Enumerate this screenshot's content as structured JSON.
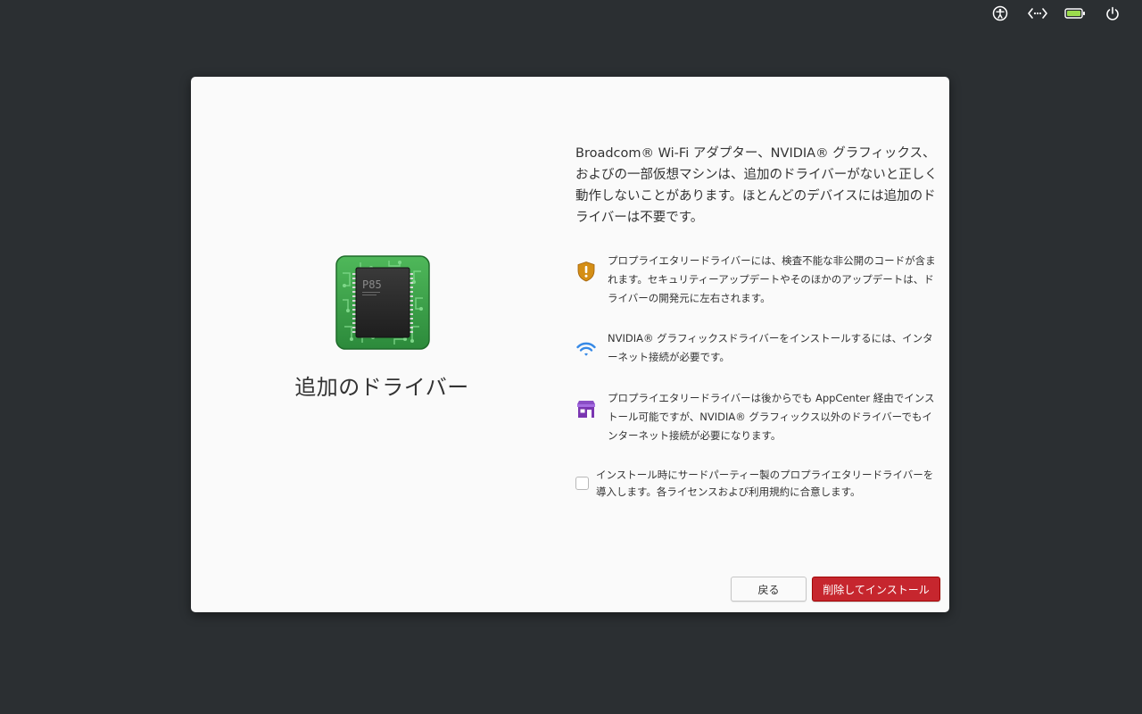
{
  "panel": {
    "indicators": [
      "accessibility-icon",
      "network-icon",
      "battery-icon",
      "power-icon"
    ]
  },
  "dialog": {
    "title": "追加のドライバー",
    "chip_label": "P85",
    "description": "Broadcom® Wi-Fi アダプター、NVIDIA® グラフィックス、およびの一部仮想マシンは、追加のドライバーがないと正しく動作しないことがあります。ほとんどのデバイスには追加のドライバーは不要です。",
    "notices": [
      {
        "icon": "security-warning-icon",
        "color": "#c87d0a",
        "text": "プロプライエタリードライバーには、検査不能な非公開のコードが含まれます。セキュリティーアップデートやそのほかのアップデートは、ドライバーの開発元に左右されます。"
      },
      {
        "icon": "wifi-icon",
        "color": "#3689e6",
        "text": "NVIDIA® グラフィックスドライバーをインストールするには、インターネット接続が必要です。"
      },
      {
        "icon": "appcenter-icon",
        "color": "#7a36b1",
        "text": "プロプライエタリードライバーは後からでも AppCenter 経由でインストール可能ですが、NVIDIA® グラフィックス以外のドライバーでもインターネット接続が必要になります。"
      }
    ],
    "consent": {
      "checked": false,
      "label": "インストール時にサードパーティー製のプロプライエタリードライバーを導入します。各ライセンスおよび利用規約に合意します。"
    },
    "buttons": {
      "back": "戻る",
      "install": "削除してインストール"
    },
    "colors": {
      "destructive": "#c6262e",
      "background": "#2b2f32",
      "window": "#fafafa"
    }
  }
}
